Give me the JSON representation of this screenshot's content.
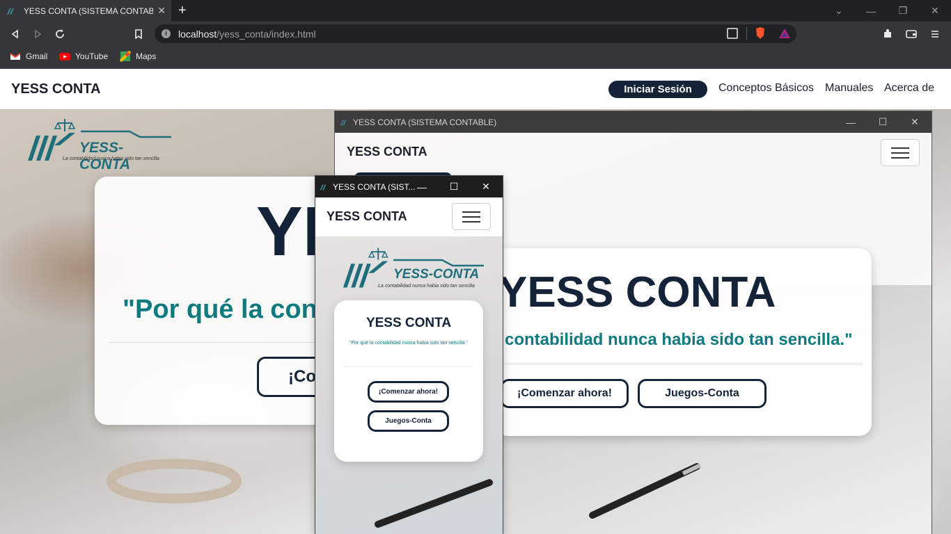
{
  "browser": {
    "tab_title": "YESS CONTA (SISTEMA CONTABLE)",
    "url_host": "localhost",
    "url_path": "/yess_conta/index.html",
    "bookmarks": [
      "Gmail",
      "YouTube",
      "Maps"
    ]
  },
  "site": {
    "brand": "YESS CONTA",
    "login_label": "Iniciar Sesión",
    "nav_links": [
      "Conceptos Básicos",
      "Manuales",
      "Acerca de"
    ],
    "logo_text": "YESS-CONTA",
    "logo_tagline": "La contabilidad nunca habia sido tan sencilla",
    "hero_big_partial": "YE",
    "hero_quote_partial": "\"Por qué la con",
    "hero_button_partial": "¡Co"
  },
  "window2": {
    "title": "YESS CONTA (SISTEMA CONTABLE)",
    "brand": "YESS CONTA",
    "hero_big": "YESS CONTA",
    "hero_quote": "contabilidad nunca habia sido tan sencilla.\"",
    "btn_start": "¡Comenzar ahora!",
    "btn_games": "Juegos-Conta"
  },
  "window3": {
    "title": "YESS CONTA (SIST...",
    "brand": "YESS CONTA",
    "logo_text": "YESS-CONTA",
    "logo_tagline": "La contabilidad nunca habia sido tan sencilla",
    "hero_big": "YESS CONTA",
    "hero_quote": "\"Por qué la contabilidad nunca habia sido tan sencilla.\"",
    "btn_start": "¡Comenzar ahora!",
    "btn_games": "Juegos-Conta"
  },
  "colors": {
    "navy": "#142338",
    "teal": "#0f7a80"
  }
}
